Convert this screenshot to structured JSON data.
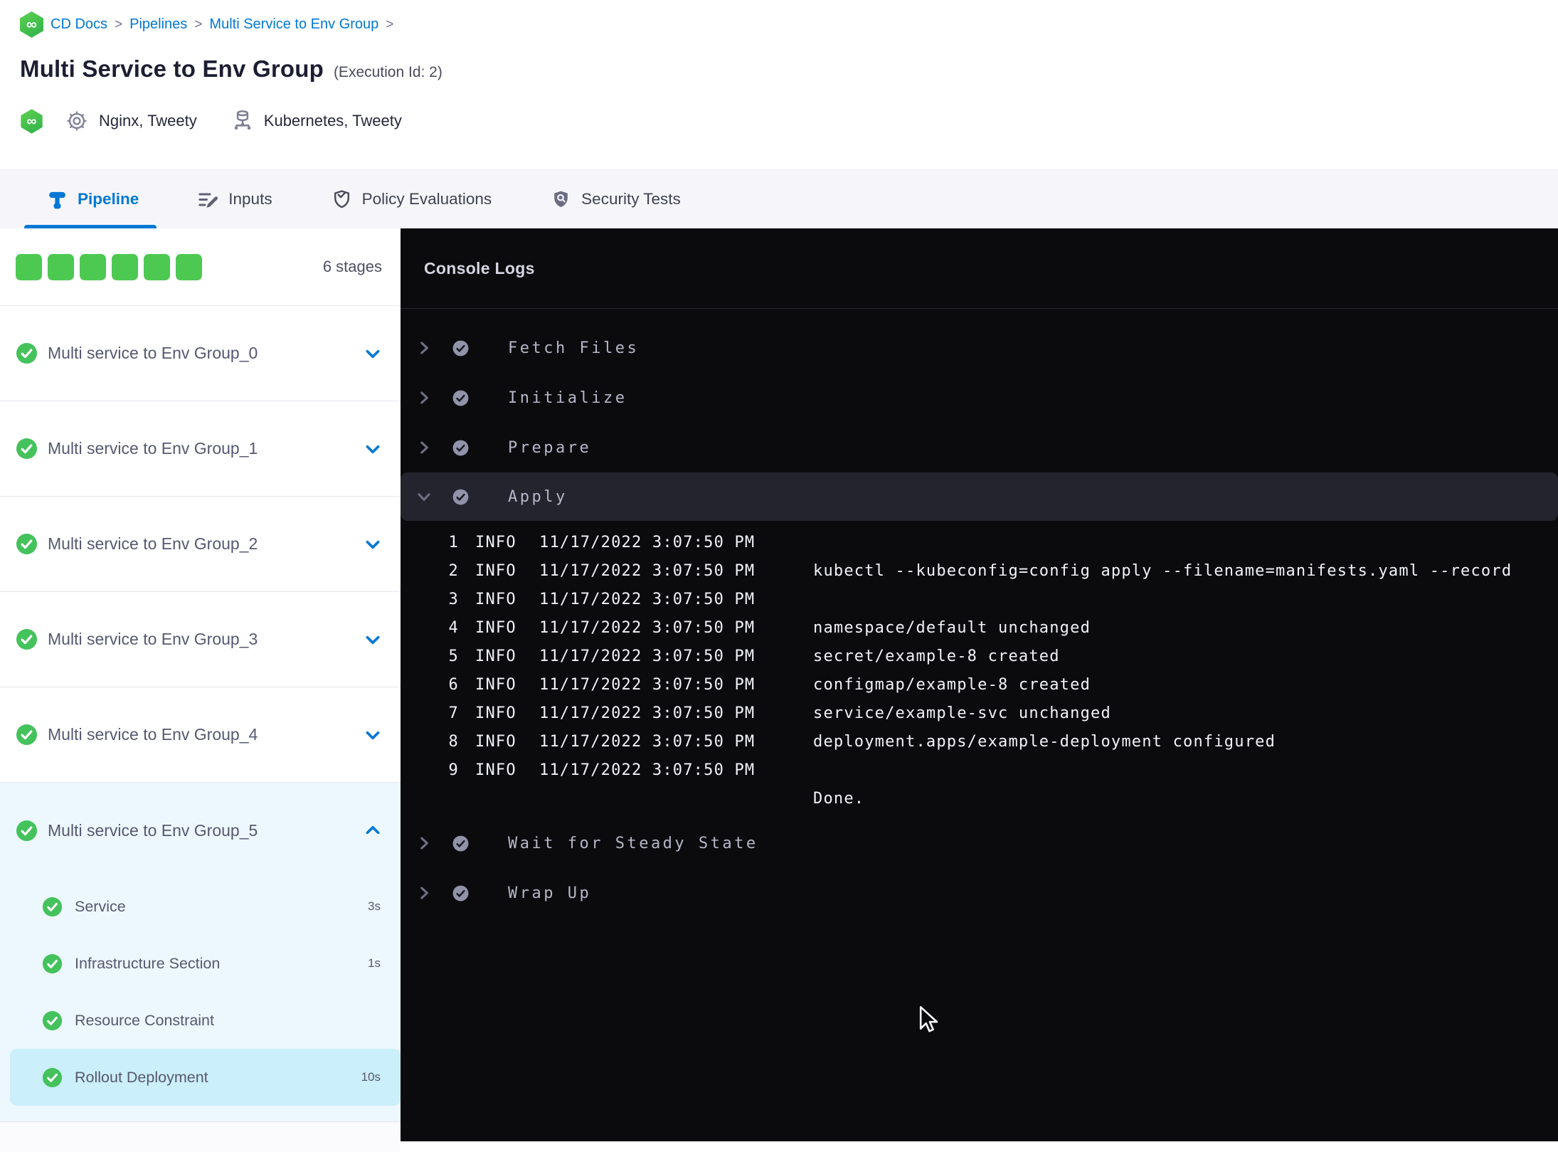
{
  "colors": {
    "accent": "#0278d5",
    "success_green": "#4dc952",
    "console_bg": "#0b0b0e",
    "selected_step_bg": "#cbeffb"
  },
  "breadcrumb": {
    "separator": ">",
    "items": [
      {
        "label": "CD Docs"
      },
      {
        "label": "Pipelines"
      },
      {
        "label": "Multi Service to Env Group"
      }
    ]
  },
  "header": {
    "title": "Multi Service to Env Group",
    "execution_id": "(Execution Id: 2)",
    "services_label": "Nginx, Tweety",
    "environments_label": "Kubernetes, Tweety"
  },
  "tabs": [
    {
      "label": "Pipeline",
      "active": true
    },
    {
      "label": "Inputs",
      "active": false
    },
    {
      "label": "Policy Evaluations",
      "active": false
    },
    {
      "label": "Security Tests",
      "active": false
    }
  ],
  "sidebar": {
    "stage_count_label": "6 stages",
    "stages": [
      {
        "name": "Multi service to Env Group_0"
      },
      {
        "name": "Multi service to Env Group_1"
      },
      {
        "name": "Multi service to Env Group_2"
      },
      {
        "name": "Multi service to Env Group_3"
      },
      {
        "name": "Multi service to Env Group_4"
      }
    ],
    "expanded_stage": {
      "name": "Multi service to Env Group_5",
      "steps": [
        {
          "name": "Service",
          "duration": "3s"
        },
        {
          "name": "Infrastructure Section",
          "duration": "1s"
        },
        {
          "name": "Resource Constraint",
          "duration": ""
        },
        {
          "name": "Rollout Deployment",
          "duration": "10s",
          "selected": true
        }
      ]
    }
  },
  "console": {
    "title": "Console Logs",
    "steps_before": [
      {
        "name": "Fetch Files"
      },
      {
        "name": "Initialize"
      },
      {
        "name": "Prepare"
      }
    ],
    "expanded_step": {
      "name": "Apply"
    },
    "steps_after": [
      {
        "name": "Wait for Steady State"
      },
      {
        "name": "Wrap Up"
      }
    ],
    "logs": [
      {
        "n": "1",
        "level": "INFO",
        "time": "11/17/2022 3:07:50 PM",
        "msg": ""
      },
      {
        "n": "2",
        "level": "INFO",
        "time": "11/17/2022 3:07:50 PM",
        "msg": "kubectl --kubeconfig=config apply --filename=manifests.yaml --record"
      },
      {
        "n": "3",
        "level": "INFO",
        "time": "11/17/2022 3:07:50 PM",
        "msg": ""
      },
      {
        "n": "4",
        "level": "INFO",
        "time": "11/17/2022 3:07:50 PM",
        "msg": "namespace/default unchanged"
      },
      {
        "n": "5",
        "level": "INFO",
        "time": "11/17/2022 3:07:50 PM",
        "msg": "secret/example-8 created"
      },
      {
        "n": "6",
        "level": "INFO",
        "time": "11/17/2022 3:07:50 PM",
        "msg": "configmap/example-8 created"
      },
      {
        "n": "7",
        "level": "INFO",
        "time": "11/17/2022 3:07:50 PM",
        "msg": "service/example-svc unchanged"
      },
      {
        "n": "8",
        "level": "INFO",
        "time": "11/17/2022 3:07:50 PM",
        "msg": "deployment.apps/example-deployment configured"
      },
      {
        "n": "9",
        "level": "INFO",
        "time": "11/17/2022 3:07:50 PM",
        "msg": ""
      }
    ],
    "done_line": "Done.",
    "infinity_glyph": "∞"
  }
}
